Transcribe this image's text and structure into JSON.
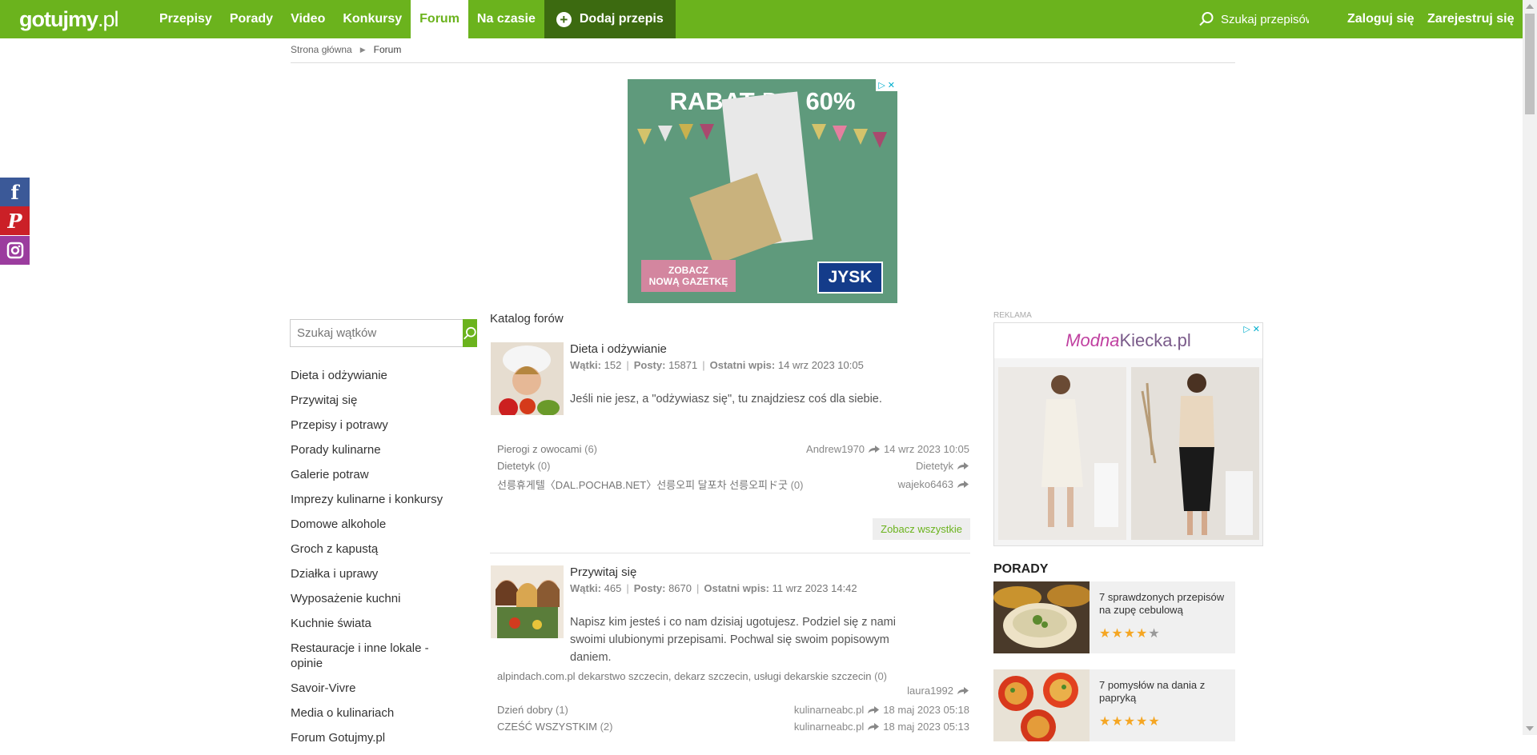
{
  "header": {
    "logo_main": "gotujmy",
    "logo_suffix": ".pl",
    "nav": [
      "Przepisy",
      "Porady",
      "Video",
      "Konkursy",
      "Forum",
      "Na czasie"
    ],
    "active_nav": "Forum",
    "add_recipe": "Dodaj przepis",
    "search_placeholder": "Szukaj przepisów",
    "login": "Zaloguj się",
    "register": "Zarejestruj się"
  },
  "breadcrumb": {
    "home": "Strona główna",
    "current": "Forum"
  },
  "social": {
    "facebook": "f",
    "pinterest": "P"
  },
  "ad_top": {
    "headline_1": "RABAT",
    "headline_2": "DO",
    "headline_3": "60%",
    "cta_1": "ZOBACZ",
    "cta_2": "NOWĄ GAZETKĘ",
    "brand": "JYSK"
  },
  "sidebar": {
    "search_placeholder": "Szukaj wątków",
    "items": [
      "Dieta i odżywianie",
      "Przywitaj się",
      "Przepisy i potrawy",
      "Porady kulinarne",
      "Galerie potraw",
      "Imprezy kulinarne i konkursy",
      "Domowe alkohole",
      "Groch z kapustą",
      "Działka i uprawy",
      "Wyposażenie kuchni",
      "Kuchnie świata",
      "Restauracje i inne lokale - opinie",
      "Savoir-Vivre",
      "Media o kulinariach",
      "Forum Gotujmy.pl"
    ]
  },
  "main": {
    "catalog_title": "Katalog forów",
    "labels": {
      "threads": "Wątki:",
      "posts": "Posty:",
      "last": "Ostatni wpis:"
    },
    "forums": [
      {
        "name": "Dieta i odżywianie",
        "threads": "152",
        "posts": "15871",
        "last": "14 wrz 2023 10:05",
        "desc": "Jeśli nie jesz, a \"odżywiasz się\", tu znajdziesz coś dla siebie.",
        "rows": [
          {
            "title": "Pierogi z owocami",
            "count": "(6)",
            "user": "Andrew1970",
            "date": "14 wrz 2023 10:05"
          },
          {
            "title": "Dietetyk",
            "count": "(0)",
            "user": "Dietetyk",
            "date": ""
          },
          {
            "title": "선릉휴게텔〈DAL.POCHAB.NET〉선릉오피 달포차 선릉오피ド굿",
            "count": "(0)",
            "user": "wajeko6463",
            "date": ""
          }
        ],
        "see_all": "Zobacz wszystkie"
      },
      {
        "name": "Przywitaj się",
        "threads": "465",
        "posts": "8670",
        "last": "11 wrz 2023 14:42",
        "desc": "Napisz kim jesteś i co nam dzisiaj ugotujesz. Podziel się z nami swoimi ulubionymi przepisami. Pochwal się swoim popisowym daniem.",
        "rows": [
          {
            "title": "alpindach.com.pl dekarstwo szczecin, dekarz szczecin, usługi dekarskie szczecin",
            "count": "(0)",
            "user": "laura1992",
            "date": ""
          },
          {
            "title": "Dzień dobry",
            "count": "(1)",
            "user": "kulinarneabc.pl",
            "date": "18 maj 2023 05:18"
          },
          {
            "title": "CZEŚĆ WSZYSTKIM",
            "count": "(2)",
            "user": "kulinarneabc.pl",
            "date": "18 maj 2023 05:13"
          }
        ]
      }
    ]
  },
  "right": {
    "reklama": "REKLAMA",
    "ad_brand_1": "Modna",
    "ad_brand_2": "Kiecka.pl",
    "porady_title": "PORADY",
    "porady": [
      {
        "title": "7 sprawdzonych przepisów na zupę cebulową",
        "rating": 4
      },
      {
        "title": "7 pomysłów na dania z papryką",
        "rating": 5
      }
    ]
  },
  "colors": {
    "brand_green": "#6bb31d",
    "dark_green": "#3c6a10",
    "facebook": "#3b5998",
    "pinterest": "#cb2027",
    "instagram": "#9b3c9e"
  }
}
